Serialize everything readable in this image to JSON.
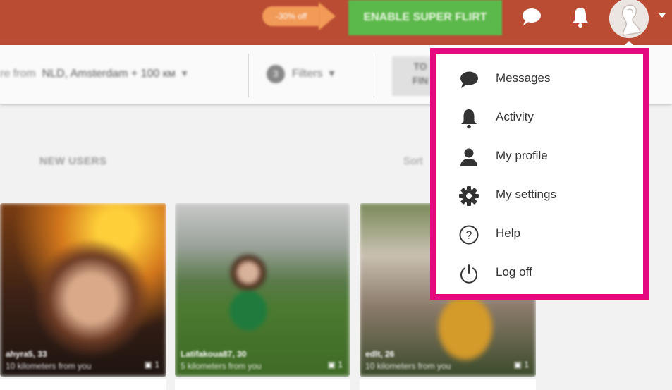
{
  "header": {
    "promo_badge": "-30% off",
    "super_flirt_label": "ENABLE SUPER FLIRT",
    "icons": [
      "chat-icon",
      "bell-icon",
      "avatar",
      "caret-down-icon"
    ],
    "colors": {
      "bar": "#b94c33",
      "promo": "#f29a57",
      "super_flirt": "#5bb84a"
    }
  },
  "search": {
    "from_label": "re from",
    "location": "NLD, Amsterdam + 100 км",
    "filters_count": "3",
    "filters_label": "Filters",
    "find_label_line1": "TO",
    "find_label_line2": "FIN"
  },
  "tabs": {
    "new_users": "NEW USERS",
    "sort_label": "Sort"
  },
  "cards": [
    {
      "name": "ahyra5, 33",
      "distance": "10 kilometers from you",
      "photos": "1"
    },
    {
      "name": "Latifakoua87, 30",
      "distance": "5 kilometers from you",
      "photos": "1"
    },
    {
      "name": "edlt, 26",
      "distance": "10 kilometers from you",
      "photos": "1"
    }
  ],
  "menu": {
    "accent_color": "#e5097f",
    "items": [
      {
        "label": "Messages",
        "icon": "chat-icon"
      },
      {
        "label": "Activity",
        "icon": "bell-icon"
      },
      {
        "label": "My profile",
        "icon": "person-icon"
      },
      {
        "label": "My settings",
        "icon": "gear-icon"
      },
      {
        "label": "Help",
        "icon": "help-icon"
      },
      {
        "label": "Log off",
        "icon": "power-icon"
      }
    ]
  }
}
